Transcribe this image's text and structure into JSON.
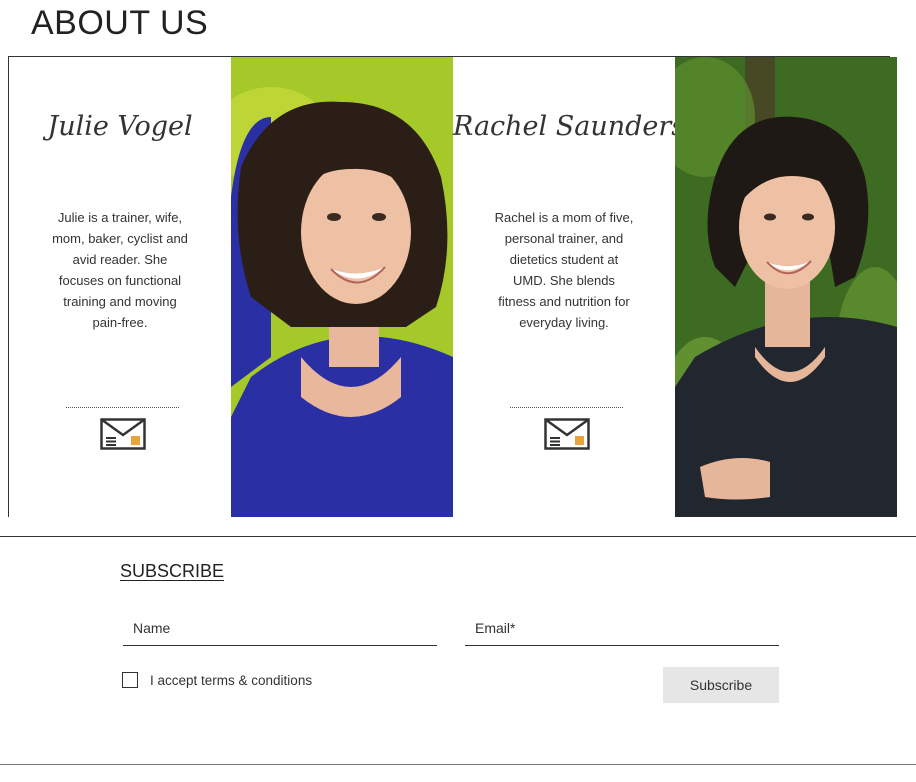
{
  "page": {
    "title": "ABOUT US"
  },
  "team": [
    {
      "name": "Julie Vogel",
      "bio": "Julie is a trainer, wife, mom, baker, cyclist and avid reader. She focuses on functional training and moving pain-free.",
      "contact_icon": "envelope-icon",
      "photo_background": "#a6c92a",
      "shirt_color": "#2a2fa3"
    },
    {
      "name": "Rachel Saunders",
      "bio": "Rachel is a mom of five, personal trainer, and dietetics student at UMD. She blends fitness and nutrition for everyday living.",
      "contact_icon": "envelope-icon",
      "photo_background": "#3e6b22",
      "shirt_color": "#22262f"
    }
  ],
  "subscribe": {
    "heading": "SUBSCRIBE",
    "name_placeholder": "Name",
    "email_placeholder": "Email*",
    "terms_label": "I accept terms & conditions",
    "terms_checked": false,
    "button_label": "Subscribe"
  },
  "colors": {
    "text": "#222222",
    "button_bg": "#e6e6e6",
    "envelope_accent": "#e8a33a"
  }
}
